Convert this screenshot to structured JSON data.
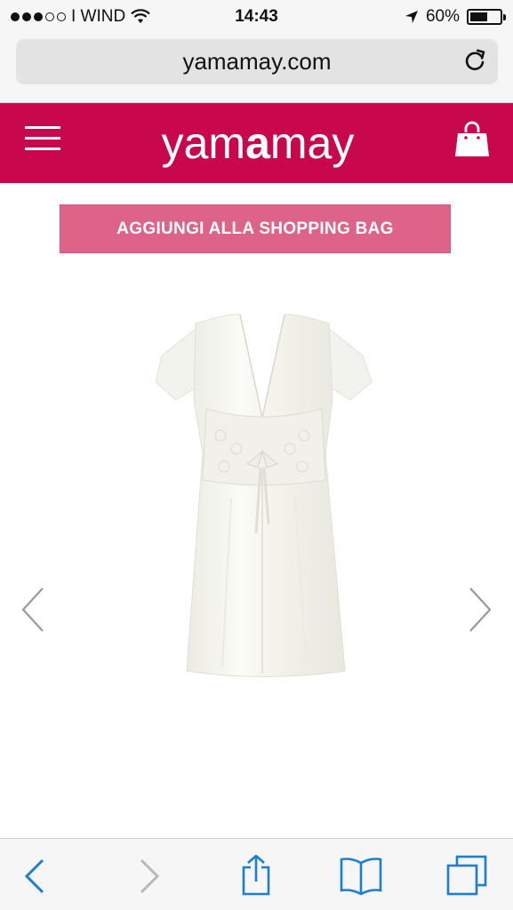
{
  "status_bar": {
    "carrier": "I WIND",
    "signal_bars_filled": 3,
    "signal_bars_total": 5,
    "time": "14:43",
    "battery_percent": "60%",
    "battery_level": 0.6
  },
  "browser": {
    "url": "yamamay.com",
    "reload_icon": "reload-icon"
  },
  "site": {
    "logo_prefix": "yam",
    "logo_bold": "a",
    "logo_suffix": "may",
    "menu_icon": "hamburger-menu-icon",
    "bag_icon": "shopping-bag-icon",
    "brand_color": "#c8084a"
  },
  "product": {
    "add_to_bag_label": "AGGIUNGI ALLA SHOPPING BAG",
    "button_color": "#de6389",
    "image_description_icon": "white-robe-image",
    "prev_icon": "chevron-left-icon",
    "next_icon": "chevron-right-icon"
  },
  "toolbar": {
    "accent": "#1a7fd4",
    "back_icon": "back-icon",
    "forward_icon": "forward-icon",
    "share_icon": "share-icon",
    "bookmarks_icon": "bookmarks-icon",
    "tabs_icon": "tabs-icon"
  }
}
